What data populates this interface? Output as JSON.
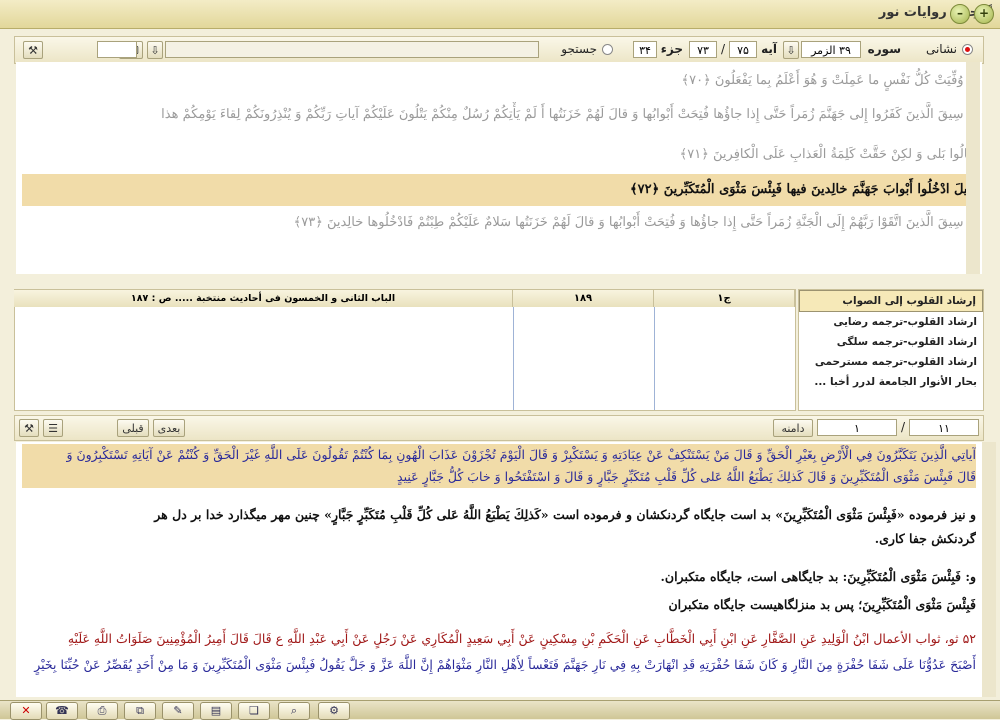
{
  "window": {
    "title": "گنجینه روایات نور"
  },
  "quran_toolbar": {
    "bookmark_label": "نشانی",
    "sura_label": "سوره",
    "sura_value": "۳۹ الزمر",
    "aya_label": "آیه",
    "aya_value": "۷۵",
    "aya_total": "۷۳",
    "juz_label": "جزء",
    "juz_value": "۳۴",
    "search_label": "جستجو"
  },
  "quran": {
    "verses": [
      {
        "text": "وَ وُفِّيَتْ كُلُّ نَفْسٍ ما عَمِلَتْ وَ هُوَ أَعْلَمُ بِما يَفْعَلُونَ ﴿۷۰﴾"
      },
      {
        "text": "وَ سِيقَ الَّذينَ كَفَرُوا إِلى‏ جَهَنَّمَ زُمَراً حَتَّى إِذا جاؤُها فُتِحَتْ أَبْوابُها وَ قالَ لَهُمْ خَزَنَتُها أَ لَمْ يَأْتِكُمْ رُسُلٌ مِنْكُمْ يَتْلُونَ عَلَيْكُمْ آياتِ رَبِّكُمْ وَ يُنْذِرُونَكُمْ لِقاءَ يَوْمِكُمْ هذا"
      },
      {
        "text": "قالُوا بَلى‏ وَ لكِنْ حَقَّتْ كَلِمَةُ الْعَذابِ عَلَى الْكافِرينَ ﴿۷۱﴾"
      },
      {
        "text": "قيلَ ادْخُلُوا أَبْوابَ جَهَنَّمَ خالِدينَ فيها فَبِئْسَ مَثْوَى الْمُتَكَبِّرينَ ﴿۷۲﴾"
      },
      {
        "text": "وَ سِيقَ الَّذينَ اتَّقَوْا رَبَّهُمْ إِلَى الْجَنَّةِ زُمَراً حَتَّى إِذا جاؤُها وَ فُتِحَتْ أَبْوابُها وَ قالَ لَهُمْ خَزَنَتُها سَلامٌ عَلَيْكُمْ طِبْتُمْ فَادْخُلُوها خالِدينَ ﴿۷۳﴾"
      }
    ]
  },
  "source_table": {
    "columns": [
      "ج۱",
      "۱۸۹",
      "الباب الثانی و الخمسون فی أحادیث منتخبة ..... ص : ۱۸۷"
    ]
  },
  "books": [
    {
      "name": "إرشاد القلوب إلی الصواب"
    },
    {
      "name": "ارشاد القلوب-ترجمه رضایی"
    },
    {
      "name": "ارشاد القلوب-ترجمه سلگی"
    },
    {
      "name": "ارشاد القلوب-ترجمه مسترحمی"
    },
    {
      "name": "بحار الأنوار الجامعة لدرر أخبا ..."
    }
  ],
  "hadith_toolbar": {
    "page_value": "۱۱",
    "page_sep": "۱",
    "range_label": "دامنه",
    "next_label": "بعدی",
    "prev_label": "قبلی"
  },
  "hadith": {
    "lines": [
      {
        "text": "آياتِي الَّذِينَ يَتَكَبَّرُونَ فِي الْأَرْضِ بِغَيْرِ الْحَقِّ وَ قَالَ مَنْ يَسْتَنْكِفْ عَنْ عِبَادَتِهِ وَ يَسْتَكْبِرْ وَ قَالَ الْيَوْمَ تُجْزَوْنَ عَذَابَ الْهُونِ بِمَا كُنْتُمْ تَقُولُونَ عَلَى اللَّهِ غَيْرَ الْحَقِّ وَ كُنْتُمْ عَنْ آيَاتِهِ تَسْتَكْبِرُونَ وَ",
        "color": "#2a2a9a",
        "highlight": true
      },
      {
        "text": "قَالَ فَبِئْسَ مَثْوَى الْمُتَكَبِّرِينَ وَ قَالَ كَذلِكَ يَطْبَعُ اللَّهُ عَلى‏ كُلِّ قَلْبِ مُتَكَبِّرٍ جَبَّارٍ وَ قَالَ وَ اسْتَفْتَحُوا وَ خابَ كُلُّ جَبَّارٍ عَنِيدٍ",
        "color": "#2a2a9a",
        "highlight": true
      },
      {
        "text": "و نیز فرموده «فَبِئْسَ مَثْوَى الْمُتَكَبِّرِينَ» بد است جایگاه گردنکشان و فرموده است «كَذلِكَ يَطْبَعُ اللَّهُ عَلى‏ كُلِّ قَلْبِ مُتَكَبِّرٍ جَبَّارٍ» چنین مهر میگذارد خدا بر دل هر",
        "color": "#111111",
        "highlight": false
      },
      {
        "text": "گردنکش جفا کاری.",
        "color": "#111111",
        "highlight": false
      },
      {
        "text": "و: فَبِئْسَ مَثْوَى الْمُتَكَبِّرِينَ: بد جایگاهی است، جایگاه متکبران.",
        "color": "#111111",
        "highlight": false
      },
      {
        "text": "فَبِئْسَ مَثْوَى الْمُتَكَبِّرِينَ؛ پس بد منزلگاهیست جایگاه متکبران",
        "color": "#111111",
        "highlight": false
      },
      {
        "text": "۵۲ ثو، ثواب الأعمال ابْنُ الْوَلِيدِ عَنِ الصَّفَّارِ عَنِ ابْنِ أَبِي الْخَطَّابِ عَنِ الْحَكَمِ بْنِ مِسْكِينٍ عَنْ أَبِي سَعِيدٍ الْمُكَارِي عَنْ رَجُلٍ عَنْ أَبِي عَبْدِ اللَّهِ ع قَالَ قَالَ أَمِيرُ الْمُؤْمِنِينَ صَلَوَاتُ اللَّهِ عَلَيْهِ",
        "color": "#a01818",
        "highlight": false
      },
      {
        "text": "أَصْبَحَ عَدُوُّنَا عَلَى شَفَا حُفْرَةٍ مِنَ النَّارِ وَ كَانَ شَفَا حُفْرَتِهِ قَدِ انْهَارَتْ بِهِ فِي نَارِ جَهَنَّمَ فَتَعْساً لِأَهْلِ النَّارِ مَثْوَاهُمْ إِنَّ اللَّهَ عَزَّ وَ جَلَّ يَقُولُ فَبِئْسَ مَثْوَى الْمُتَكَبِّرِينَ وَ مَا مِنْ أَحَدٍ يُقَصِّرُ عَنْ حُبِّنَا بِخَيْرٍ",
        "color": "#2a2a9a",
        "highlight": false
      }
    ]
  },
  "taskbar": {
    "icons": [
      "close-red",
      "phone",
      "print",
      "copy",
      "note",
      "doc",
      "bookmark",
      "search",
      "settings"
    ]
  }
}
